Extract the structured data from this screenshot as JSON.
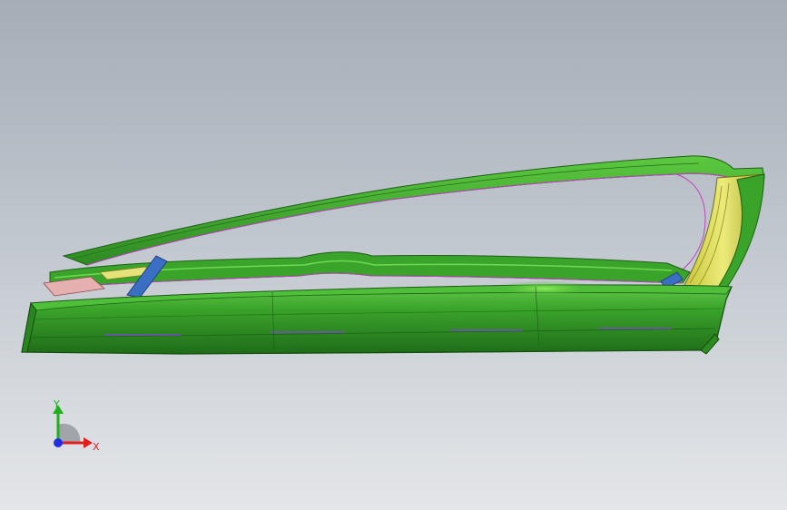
{
  "viewport": {
    "background_top": "#a5adb6",
    "background_bottom": "#e4e6e9"
  },
  "model": {
    "body_color": "#3aa42a",
    "highlight_color": "#5fd244",
    "shadow_color": "#1e6a18",
    "trim_color": "#d8d64a",
    "bracket_color": "#3b6fc4",
    "edge_color": "#c040c0"
  },
  "triad": {
    "x_label": "X",
    "y_label": "Y",
    "x_color": "#e02020",
    "y_color": "#20b020",
    "z_color": "#2030e0"
  }
}
